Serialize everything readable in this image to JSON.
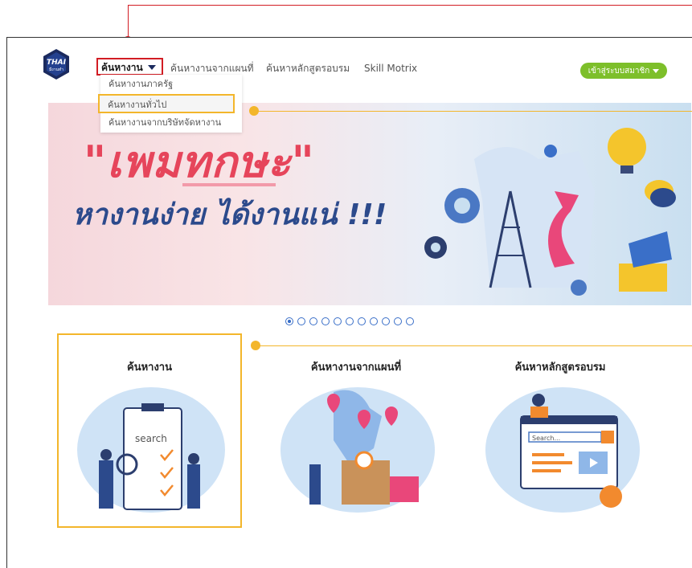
{
  "header": {
    "logo_text": "THAI",
    "logo_sub": "มีงานทำ",
    "nav": [
      {
        "label": "ค้นหางาน"
      },
      {
        "label": "ค้นหางานจากแผนที่"
      },
      {
        "label": "ค้นหาหลักสูตรอบรม"
      },
      {
        "label": "Skill Motrix"
      }
    ],
    "login_label": "เข้าสู่ระบบสมาชิก"
  },
  "dropdown": {
    "items": [
      {
        "label": "ค้นหางานภาครัฐ"
      },
      {
        "label": "ค้นหางานทั่วไป"
      },
      {
        "label": "ค้นหางานจากบริษัทจัดหางาน"
      }
    ]
  },
  "banner": {
    "title": "\"เพมทกษะ\"",
    "subtitle": "หางานง่าย ได้งานแน่ !!!"
  },
  "carousel": {
    "count": 11,
    "active": 1
  },
  "cards": [
    {
      "title": "ค้นหางาน",
      "image_label": "search"
    },
    {
      "title": "ค้นหางานจากแผนที่"
    },
    {
      "title": "ค้นหาหลักสูตรอบรม",
      "image_label": "Search..."
    }
  ],
  "colors": {
    "highlight_red": "#d21d24",
    "highlight_yellow": "#f3b62b",
    "login_green": "#7dbf2a",
    "brand_blue": "#1b2a5e"
  }
}
